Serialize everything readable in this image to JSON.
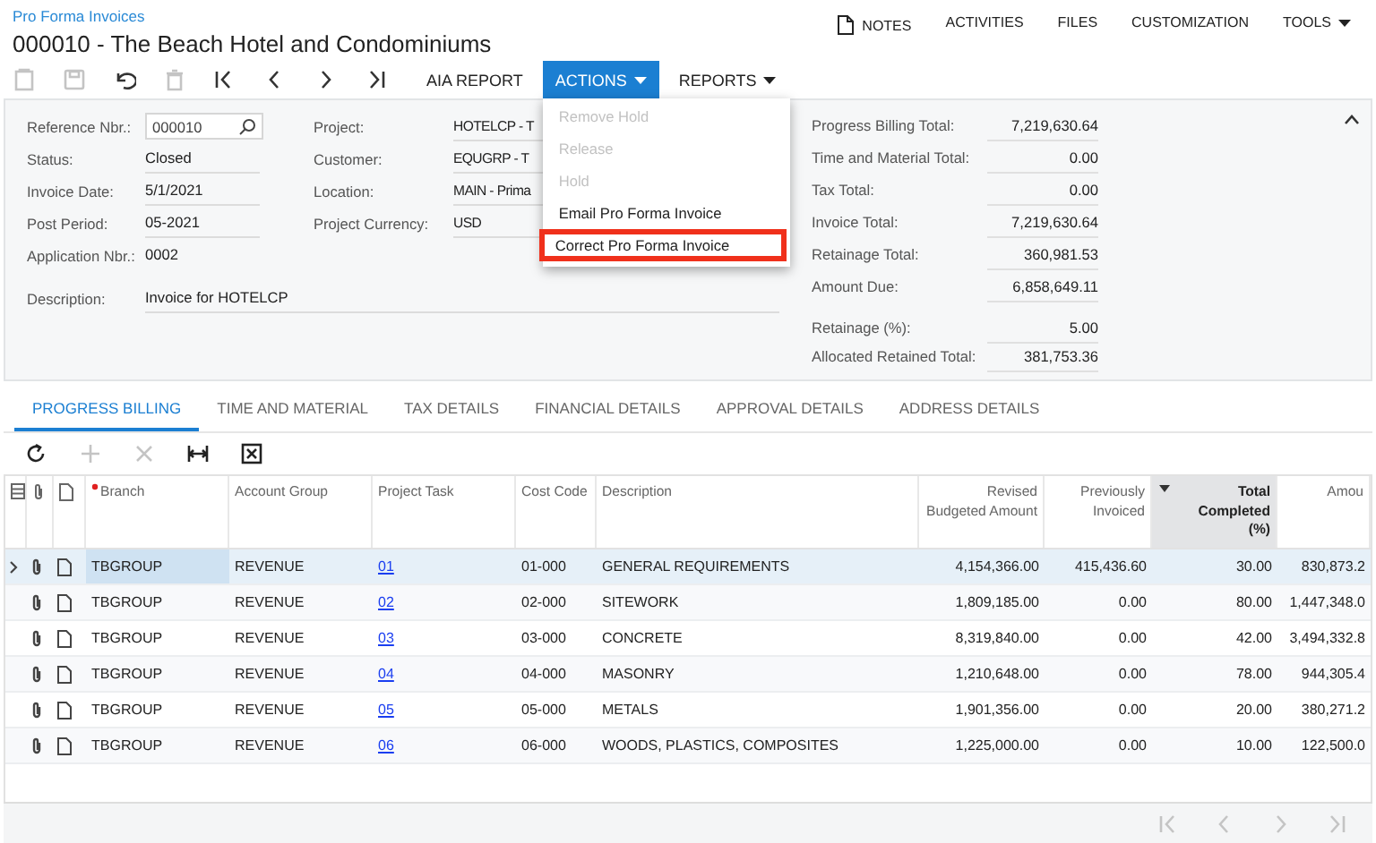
{
  "breadcrumb": "Pro Forma Invoices",
  "title": "000010 - The Beach Hotel and Condominiums",
  "top_links": [
    {
      "label": "NOTES",
      "kind": "note"
    },
    {
      "label": "ACTIVITIES",
      "kind": "plain"
    },
    {
      "label": "FILES",
      "kind": "plain"
    },
    {
      "label": "CUSTOMIZATION",
      "kind": "plain"
    },
    {
      "label": "TOOLS",
      "kind": "menu"
    }
  ],
  "toolbar": {
    "icons": [
      {
        "kind": "clipboard",
        "disabled": true
      },
      {
        "kind": "save",
        "disabled": true
      },
      {
        "kind": "undo",
        "disabled": false
      },
      {
        "kind": "delete",
        "disabled": true
      },
      {
        "kind": "first",
        "disabled": false
      },
      {
        "kind": "prev",
        "disabled": false
      },
      {
        "kind": "next",
        "disabled": false
      },
      {
        "kind": "last",
        "disabled": false
      }
    ],
    "buttons": [
      {
        "label": "AIA REPORT",
        "dropdown": false,
        "selected": false
      },
      {
        "label": "ACTIONS",
        "dropdown": true,
        "selected": true
      },
      {
        "label": "REPORTS",
        "dropdown": true,
        "selected": false
      }
    ]
  },
  "actions_menu": [
    {
      "label": "Remove Hold",
      "disabled": true,
      "highlighted": false
    },
    {
      "label": "Release",
      "disabled": true,
      "highlighted": false
    },
    {
      "label": "Hold",
      "disabled": true,
      "highlighted": false
    },
    {
      "label": "Email Pro Forma Invoice",
      "disabled": false,
      "highlighted": false
    },
    {
      "label": "Correct Pro Forma Invoice",
      "disabled": false,
      "highlighted": true
    }
  ],
  "form": {
    "left": [
      {
        "label": "Reference Nbr.:",
        "value": "000010",
        "kind": "lookup"
      },
      {
        "label": "Status:",
        "value": "Closed",
        "kind": "text"
      },
      {
        "label": "Invoice Date:",
        "value": "5/1/2021",
        "kind": "text"
      },
      {
        "label": "Post Period:",
        "value": "05-2021",
        "kind": "text"
      },
      {
        "label": "Application Nbr.:",
        "value": "0002",
        "kind": "plain"
      }
    ],
    "middle": [
      {
        "label": "Project:",
        "value": "HOTELCP - T"
      },
      {
        "label": "Customer:",
        "value": "EQUGRP - T"
      },
      {
        "label": "Location:",
        "value": "MAIN - Prima"
      },
      {
        "label": "Project Currency:",
        "value": "USD"
      }
    ],
    "description": {
      "label": "Description:",
      "value": "Invoice for HOTELCP"
    },
    "totals": [
      {
        "label": "Progress Billing Total:",
        "value": "7,219,630.64"
      },
      {
        "label": "Time and Material Total:",
        "value": "0.00"
      },
      {
        "label": "Tax Total:",
        "value": "0.00"
      },
      {
        "label": "Invoice Total:",
        "value": "7,219,630.64"
      },
      {
        "label": "Retainage Total:",
        "value": "360,981.53"
      },
      {
        "label": "Amount Due:",
        "value": "6,858,649.11"
      }
    ],
    "retainage": [
      {
        "label": "Retainage (%):",
        "value": "5.00"
      },
      {
        "label": "Allocated Retained Total:",
        "value": "381,753.36"
      }
    ]
  },
  "tabs": [
    {
      "label": "PROGRESS BILLING",
      "selected": true
    },
    {
      "label": "TIME AND MATERIAL",
      "selected": false
    },
    {
      "label": "TAX DETAILS",
      "selected": false
    },
    {
      "label": "FINANCIAL DETAILS",
      "selected": false
    },
    {
      "label": "APPROVAL DETAILS",
      "selected": false
    },
    {
      "label": "ADDRESS DETAILS",
      "selected": false
    }
  ],
  "grid_toolbar": [
    {
      "kind": "refresh",
      "disabled": false
    },
    {
      "kind": "add",
      "disabled": true
    },
    {
      "kind": "remove",
      "disabled": true
    },
    {
      "kind": "fit",
      "disabled": false
    },
    {
      "kind": "excel",
      "disabled": false
    }
  ],
  "table": {
    "columns": [
      {
        "label": "Branch",
        "required": true,
        "sorted": false
      },
      {
        "label": "Account Group",
        "required": false,
        "sorted": false
      },
      {
        "label": "Project Task",
        "required": false,
        "sorted": false
      },
      {
        "label": "Cost Code",
        "required": false,
        "sorted": false
      },
      {
        "label": "Description",
        "required": false,
        "sorted": false
      },
      {
        "label": "Revised Budgeted Amount",
        "required": false,
        "sorted": false
      },
      {
        "label": "Previously Invoiced",
        "required": false,
        "sorted": false
      },
      {
        "label": "Total Completed (%)",
        "required": false,
        "sorted": true
      },
      {
        "label": "Amou",
        "required": false,
        "sorted": false
      }
    ],
    "rows": [
      {
        "selected": true,
        "cells": [
          "TBGROUP",
          "REVENUE",
          "01",
          "01-000",
          "GENERAL REQUIREMENTS",
          "4,154,366.00",
          "415,436.60",
          "30.00",
          "830,873.2"
        ]
      },
      {
        "selected": false,
        "cells": [
          "TBGROUP",
          "REVENUE",
          "02",
          "02-000",
          "SITEWORK",
          "1,809,185.00",
          "0.00",
          "80.00",
          "1,447,348.0"
        ]
      },
      {
        "selected": false,
        "cells": [
          "TBGROUP",
          "REVENUE",
          "03",
          "03-000",
          "CONCRETE",
          "8,319,840.00",
          "0.00",
          "42.00",
          "3,494,332.8"
        ]
      },
      {
        "selected": false,
        "cells": [
          "TBGROUP",
          "REVENUE",
          "04",
          "04-000",
          "MASONRY",
          "1,210,648.00",
          "0.00",
          "78.00",
          "944,305.4"
        ]
      },
      {
        "selected": false,
        "cells": [
          "TBGROUP",
          "REVENUE",
          "05",
          "05-000",
          "METALS",
          "1,901,356.00",
          "0.00",
          "20.00",
          "380,271.2"
        ]
      },
      {
        "selected": false,
        "cells": [
          "TBGROUP",
          "REVENUE",
          "06",
          "06-000",
          "WOODS, PLASTICS, COMPOSITES",
          "1,225,000.00",
          "0.00",
          "10.00",
          "122,500.0"
        ]
      }
    ]
  }
}
